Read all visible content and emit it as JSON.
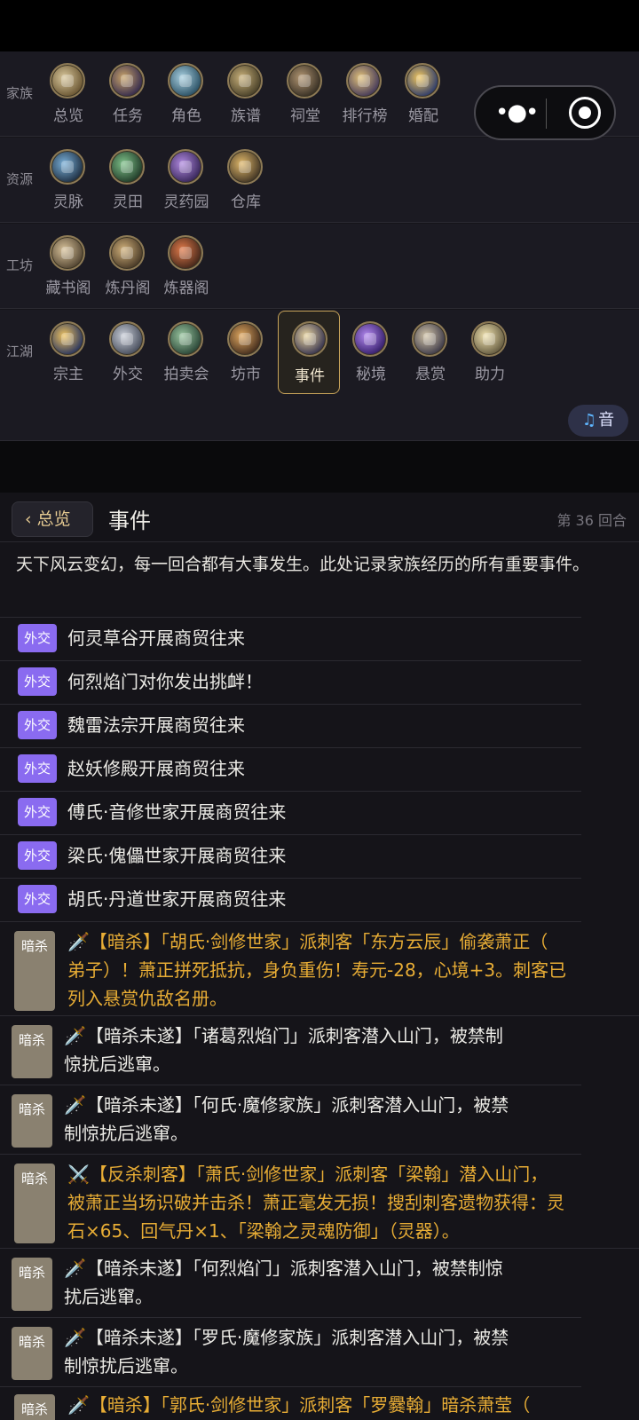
{
  "sections": [
    {
      "label": "家族",
      "items": [
        {
          "label": "总览",
          "icon": "family-overview-icon"
        },
        {
          "label": "任务",
          "icon": "quest-icon"
        },
        {
          "label": "角色",
          "icon": "character-icon"
        },
        {
          "label": "族谱",
          "icon": "family-tree-icon"
        },
        {
          "label": "祠堂",
          "icon": "ancestral-hall-icon"
        },
        {
          "label": "排行榜",
          "icon": "leaderboard-icon"
        },
        {
          "label": "婚配",
          "icon": "marriage-icon"
        }
      ]
    },
    {
      "label": "资源",
      "items": [
        {
          "label": "灵脉",
          "icon": "spirit-vein-icon"
        },
        {
          "label": "灵田",
          "icon": "spirit-field-icon"
        },
        {
          "label": "灵药园",
          "icon": "herb-garden-icon"
        },
        {
          "label": "仓库",
          "icon": "warehouse-icon"
        }
      ]
    },
    {
      "label": "工坊",
      "items": [
        {
          "label": "藏书阁",
          "icon": "library-icon"
        },
        {
          "label": "炼丹阁",
          "icon": "alchemy-icon"
        },
        {
          "label": "炼器阁",
          "icon": "forge-icon"
        }
      ]
    },
    {
      "label": "江湖",
      "items": [
        {
          "label": "宗主",
          "icon": "sect-master-icon"
        },
        {
          "label": "外交",
          "icon": "diplomacy-icon"
        },
        {
          "label": "拍卖会",
          "icon": "auction-icon"
        },
        {
          "label": "坊市",
          "icon": "market-icon"
        },
        {
          "label": "事件",
          "icon": "event-icon"
        },
        {
          "label": "秘境",
          "icon": "secret-realm-icon"
        },
        {
          "label": "悬赏",
          "icon": "bounty-icon"
        },
        {
          "label": "助力",
          "icon": "boost-icon"
        }
      ]
    }
  ],
  "music_button": {
    "icon": "♫",
    "label": "音"
  },
  "header": {
    "back_label": "‹ 总览",
    "title": "事件",
    "round": "第 36 回合"
  },
  "intro": "天下风云变幻，每一回合都有大事发生。此处记录家族经历的所有重要事件。",
  "diplomacy_events": [
    {
      "tag": "外交",
      "text": "何灵草谷开展商贸往来"
    },
    {
      "tag": "外交",
      "text": "何烈焰门对你发出挑衅！"
    },
    {
      "tag": "外交",
      "text": "魏雷法宗开展商贸往来"
    },
    {
      "tag": "外交",
      "text": "赵妖修殿开展商贸往来"
    },
    {
      "tag": "外交",
      "text": "傅氏·音修世家开展商贸往来"
    },
    {
      "tag": "外交",
      "text": "梁氏·傀儡世家开展商贸往来"
    },
    {
      "tag": "外交",
      "text": "胡氏·丹道世家开展商贸往来"
    }
  ],
  "assassination_events": [
    {
      "tag": "暗杀",
      "lines": [
        "🗡️【暗杀】「胡氏·剑修世家」派刺客「东方云辰」偷袭萧正（",
        "弟子）！萧正拼死抵抗，身负重伤！寿元-28，心境+3。刺客已",
        "列入悬赏仇敌名册。"
      ]
    },
    {
      "tag": "暗杀",
      "lines": [
        "🗡️【暗杀未遂】「诸葛烈焰门」派刺客潜入山门，被禁制",
        "惊扰后逃窜。"
      ]
    },
    {
      "tag": "暗杀",
      "lines": [
        "🗡️【暗杀未遂】「何氏·魔修家族」派刺客潜入山门，被禁",
        "制惊扰后逃窜。"
      ]
    },
    {
      "tag": "暗杀",
      "lines": [
        "⚔️【反杀刺客】「萧氏·剑修世家」派刺客「梁翰」潜入山门，",
        "被萧正当场识破并击杀！萧正毫发无损！搜刮刺客遗物获得：灵",
        "石×65、回气丹×1、「梁翰之灵魂防御」（灵器）。"
      ]
    },
    {
      "tag": "暗杀",
      "lines": [
        "🗡️【暗杀未遂】「何烈焰门」派刺客潜入山门，被禁制惊",
        "扰后逃窜。"
      ]
    },
    {
      "tag": "暗杀",
      "lines": [
        "🗡️【暗杀未遂】「罗氏·魔修家族」派刺客潜入山门，被禁",
        "制惊扰后逃窜。"
      ]
    },
    {
      "tag": "暗杀",
      "lines": [
        "🗡️【暗杀】「郭氏·剑修世家」派刺客「罗爨翰」暗杀萧莹（"
      ]
    }
  ]
}
